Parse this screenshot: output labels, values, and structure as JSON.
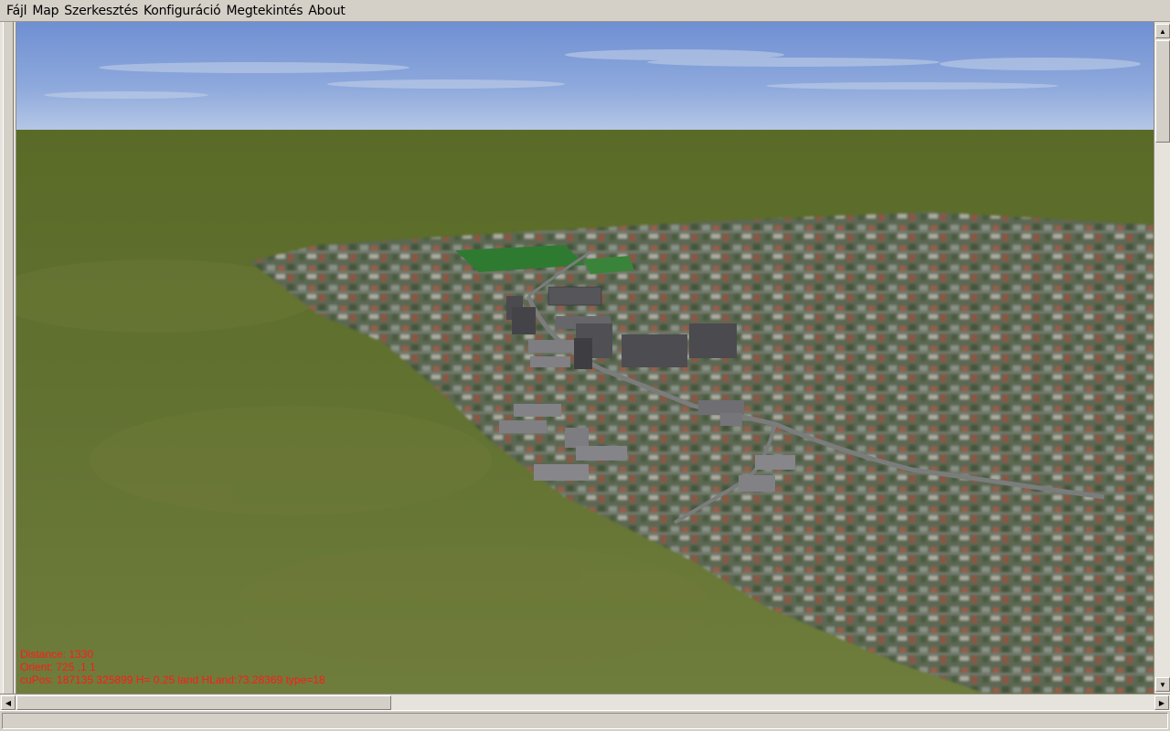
{
  "menu": {
    "items": [
      "Fájl",
      "Map",
      "Szerkesztés",
      "Konfiguráció",
      "Megtekintés",
      "About"
    ]
  },
  "hud": {
    "distance": "Distance: 1330",
    "orient": "Orient: 725 ,1 1",
    "position": "cuPos: 187135 325899 H= 0.25 land HLand:73.28369 type=18"
  },
  "colors": {
    "hud_text": "#ff1a1a",
    "sky": "#8aa8dc",
    "grass": "#5d6b2c",
    "city": "#5f6b56"
  },
  "icons": {
    "scroll_up": "triangle-up-icon",
    "scroll_down": "triangle-down-icon",
    "scroll_left": "triangle-left-icon",
    "scroll_right": "triangle-right-icon"
  }
}
